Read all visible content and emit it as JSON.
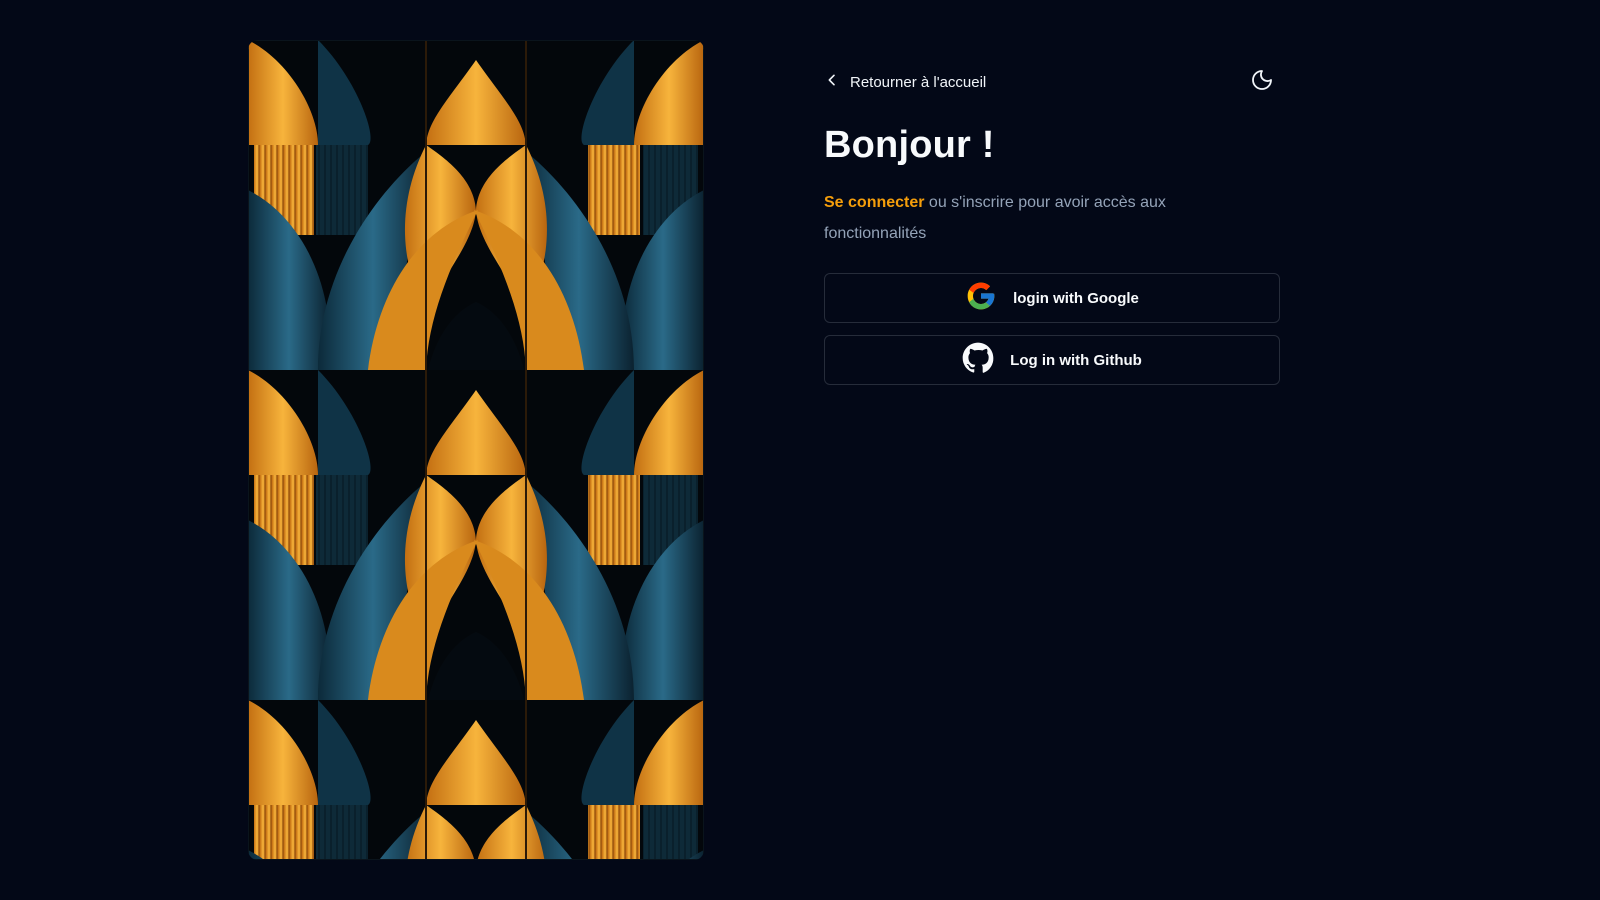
{
  "nav": {
    "back_label": "Retourner à l'accueil",
    "back_icon": "chevron-left-icon",
    "theme_icon": "moon-icon"
  },
  "auth": {
    "title": "Bonjour !",
    "subtitle_accent": "Se connecter",
    "subtitle_rest": " ou s'inscrire pour avoir accès aux fonctionnalités",
    "google_label": "login with Google",
    "github_label": "Log in with Github"
  },
  "colors": {
    "background": "#030817",
    "accent": "#f59e0b",
    "muted_text": "#94a3b8",
    "button_border": "#262c3a",
    "pattern_orange": "#f2a129",
    "pattern_teal": "#1f5c78"
  }
}
